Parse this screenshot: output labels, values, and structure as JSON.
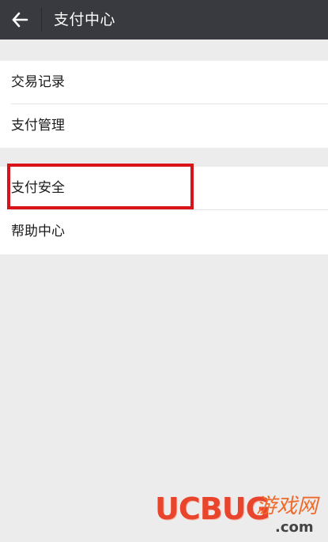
{
  "header": {
    "title": "支付中心",
    "back_icon": "arrow-left-icon"
  },
  "groups": [
    {
      "items": [
        {
          "label": "交易记录"
        },
        {
          "label": "支付管理"
        }
      ]
    },
    {
      "items": [
        {
          "label": "支付安全"
        },
        {
          "label": "帮助中心"
        }
      ]
    }
  ],
  "highlight_color": "#d8141a",
  "colors": {
    "header_bg": "#393a3f",
    "page_bg": "#ececec",
    "card_bg": "#ffffff"
  },
  "watermark": {
    "main": "UCBUG",
    "side": "游戏网",
    "domain": ".com"
  }
}
